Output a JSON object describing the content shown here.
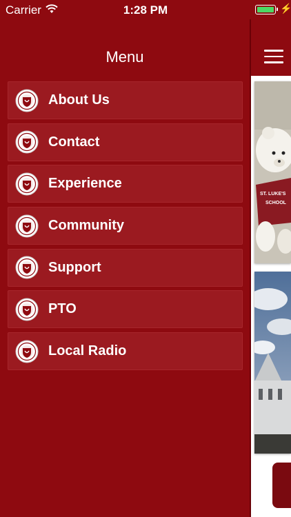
{
  "status_bar": {
    "carrier": "Carrier",
    "time": "1:28 PM"
  },
  "menu": {
    "title": "Menu",
    "items": [
      {
        "label": "About Us"
      },
      {
        "label": "Contact"
      },
      {
        "label": "Experience"
      },
      {
        "label": "Community"
      },
      {
        "label": "Support"
      },
      {
        "label": "PTO"
      },
      {
        "label": "Local Radio"
      }
    ]
  },
  "colors": {
    "brand": "#8e0a10",
    "item_bg": "#9b1a20",
    "battery": "#4cd964"
  },
  "icons": [
    "wifi-icon",
    "battery-icon",
    "charging-bolt-icon",
    "school-seal-icon",
    "hamburger-menu-icon"
  ]
}
